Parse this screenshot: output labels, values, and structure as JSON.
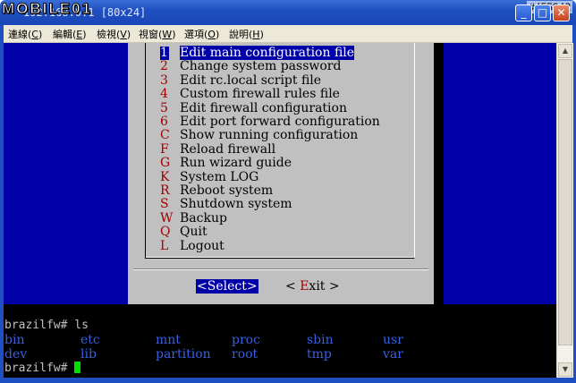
{
  "window": {
    "title": "192.168.0.1 [80x24]",
    "watermark": "MOBILE01",
    "badge": "#455942",
    "min_glyph": "_",
    "max_glyph": "□",
    "close_glyph": "✕"
  },
  "menubar": [
    {
      "label": "連線(",
      "hot": "C",
      "tail": ")"
    },
    {
      "label": "編輯(",
      "hot": "E",
      "tail": ")"
    },
    {
      "label": "檢視(",
      "hot": "V",
      "tail": ")"
    },
    {
      "label": "視窗(",
      "hot": "W",
      "tail": ")"
    },
    {
      "label": "選項(",
      "hot": "O",
      "tail": ")"
    },
    {
      "label": "說明(",
      "hot": "H",
      "tail": ")"
    }
  ],
  "dialog": {
    "items": [
      {
        "key": "1",
        "label": "Edit main configuration file",
        "selected": true
      },
      {
        "key": "2",
        "label": "Change system password"
      },
      {
        "key": "3",
        "label": "Edit rc.local script file"
      },
      {
        "key": "4",
        "label": "Custom firewall rules file"
      },
      {
        "key": "5",
        "label": "Edit firewall configuration"
      },
      {
        "key": "6",
        "label": "Edit port forward configuration"
      },
      {
        "key": "C",
        "label": "Show running configuration"
      },
      {
        "key": "F",
        "label": "Reload firewall"
      },
      {
        "key": "G",
        "label": "Run wizard guide"
      },
      {
        "key": "K",
        "label": "System LOG"
      },
      {
        "key": "R",
        "label": "Reboot system"
      },
      {
        "key": "S",
        "label": "Shutdown system"
      },
      {
        "key": "W",
        "label": "Backup"
      },
      {
        "key": "Q",
        "label": "Quit"
      },
      {
        "key": "L",
        "label": "Logout"
      }
    ],
    "select_button": "<Select>",
    "exit_prefix": "< ",
    "exit_hot": "E",
    "exit_rest": "xit >"
  },
  "shell": {
    "command_line": "brazilfw# ls",
    "prompt": "brazilfw# ",
    "ls_row1": [
      "bin",
      "etc",
      "mnt",
      "proc",
      "sbin",
      "usr"
    ],
    "ls_row2": [
      "dev",
      "lib",
      "partition",
      "root",
      "tmp",
      "var"
    ]
  },
  "scrollbar": {
    "up_glyph": "▲",
    "down_glyph": "▼"
  }
}
